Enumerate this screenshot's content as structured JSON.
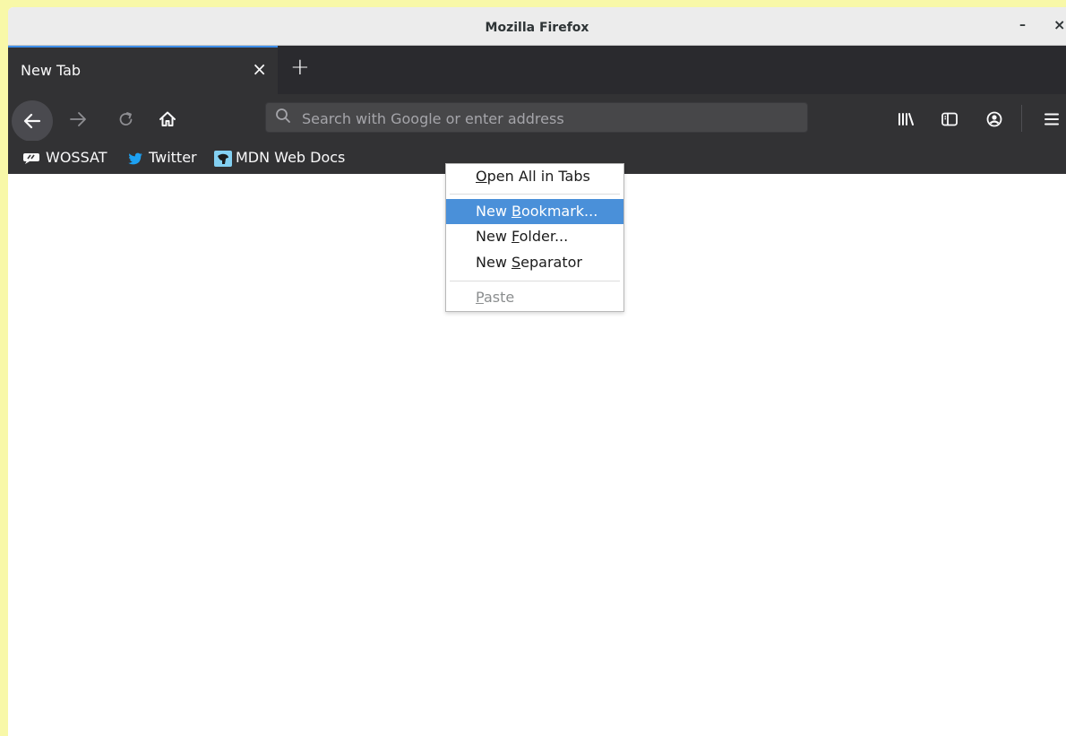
{
  "window": {
    "title": "Mozilla Firefox",
    "minimize_label": "–",
    "close_label": "×"
  },
  "tabs": [
    {
      "title": "New Tab",
      "close_label": "×"
    }
  ],
  "new_tab_label": "+",
  "navbar": {
    "back_icon": "back-arrow-icon",
    "forward_icon": "forward-arrow-icon",
    "reload_icon": "reload-icon",
    "home_icon": "home-icon",
    "url_placeholder": "Search with Google or enter address",
    "library_icon": "library-icon",
    "sidebar_icon": "sidebar-icon",
    "account_icon": "account-icon",
    "menu_icon": "hamburger-menu-icon"
  },
  "bookmarks": [
    {
      "label": "WOSSAT",
      "icon": "speech-bubble-icon"
    },
    {
      "label": "Twitter",
      "icon": "twitter-bird-icon"
    },
    {
      "label": "MDN Web Docs",
      "icon": "mdn-logo-icon"
    }
  ],
  "context_menu": {
    "items": [
      {
        "pre": "",
        "key": "O",
        "post": "pen All in Tabs"
      },
      {
        "pre": "New ",
        "key": "B",
        "post": "ookmark..."
      },
      {
        "pre": "New ",
        "key": "F",
        "post": "older..."
      },
      {
        "pre": "New ",
        "key": "S",
        "post": "eparator"
      },
      {
        "pre": "",
        "key": "P",
        "post": "aste"
      }
    ],
    "highlighted_item": "New Bookmark...",
    "disabled_item": "Paste"
  },
  "colors": {
    "toolbar_bg": "#323234",
    "tab_accent": "#3d8ee9",
    "menu_highlight": "#4a90d9",
    "desktop_bg": "#f8f8a8"
  }
}
